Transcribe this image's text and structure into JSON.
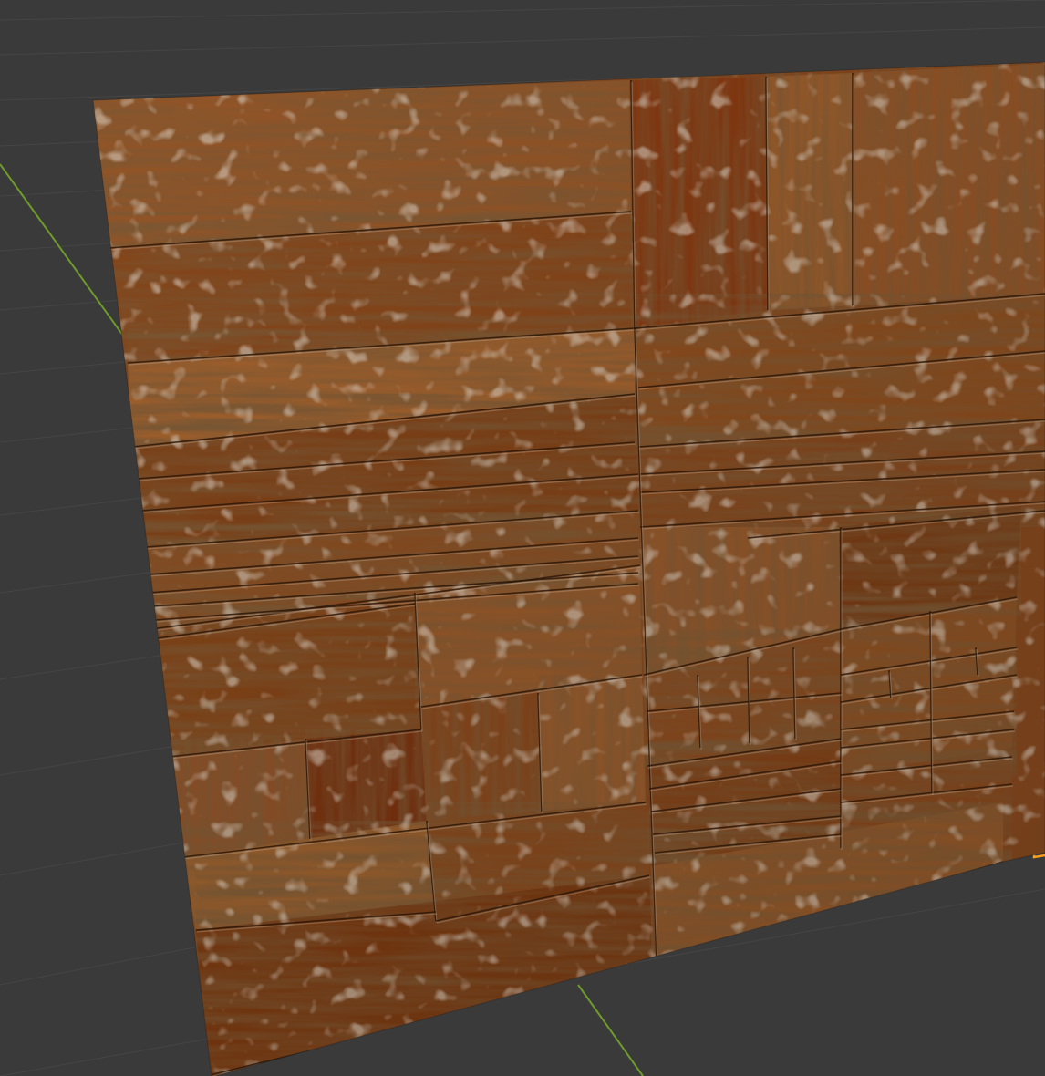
{
  "viewport": {
    "background": "#3a3a3a",
    "grid_line_color": "#454545",
    "y_axis_color": "#6f9a2c",
    "selection_outline_color": "#ff9e1b"
  },
  "panel": {
    "material": "wood-parquet",
    "base_color": "#8a4b1f",
    "edge_wear_color": "#c9b39a",
    "seam_color": "#2c1709"
  }
}
